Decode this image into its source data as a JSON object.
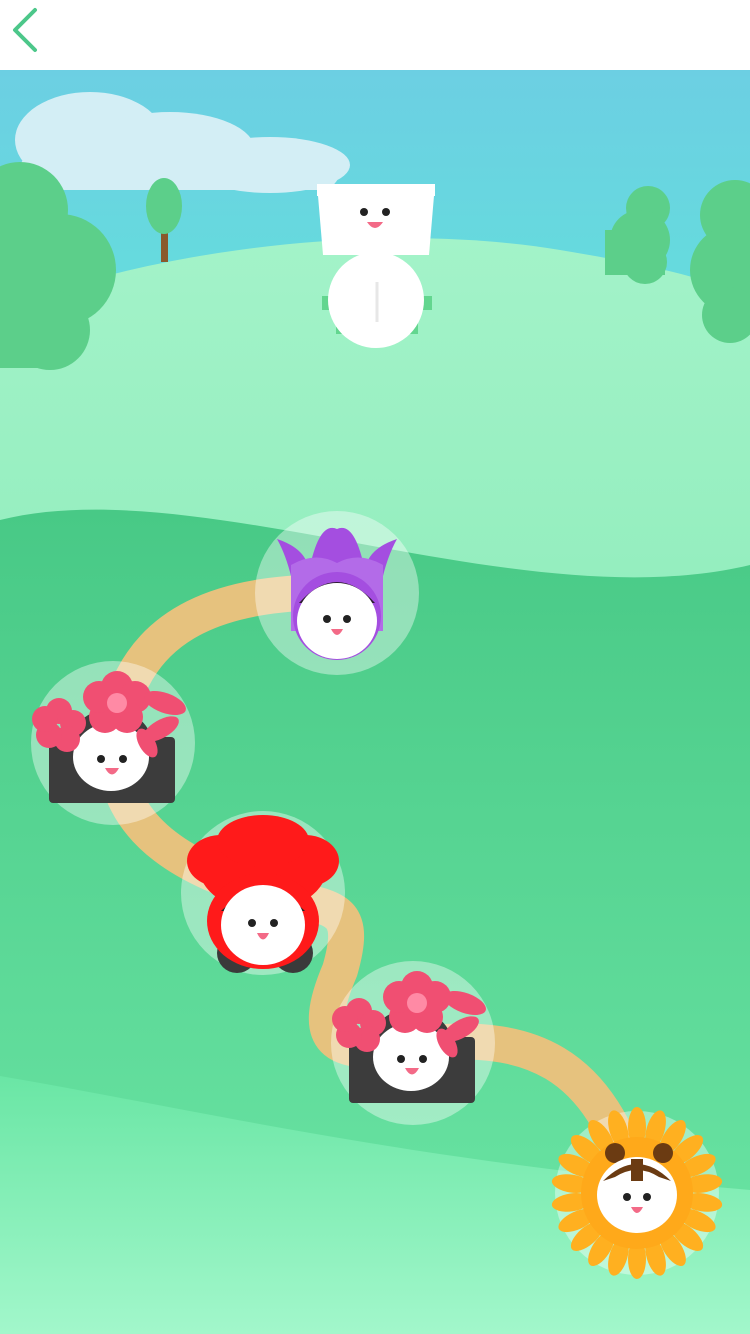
{
  "header": {
    "back_icon": "chevron-left-icon"
  },
  "colors": {
    "sky_top": "#6ccfe3",
    "sky_bottom": "#5fe6d8",
    "hill_light": "#9ff2c4",
    "hill_mid": "#6fe2a3",
    "hill_dark": "#47c985",
    "bush": "#5ccf8a",
    "path": "#e6c27e",
    "accent": "#4cc78a"
  },
  "level_map": {
    "mascot": "smiling-flowerpot-character",
    "levels": [
      {
        "id": 1,
        "flower": "purple-tulip",
        "state": "unlocked"
      },
      {
        "id": 2,
        "flower": "cherry-blossom",
        "state": "unlocked"
      },
      {
        "id": 3,
        "flower": "red-rose",
        "state": "unlocked"
      },
      {
        "id": 4,
        "flower": "cherry-blossom",
        "state": "unlocked"
      },
      {
        "id": 5,
        "flower": "sunflower",
        "state": "unlocked"
      }
    ]
  }
}
